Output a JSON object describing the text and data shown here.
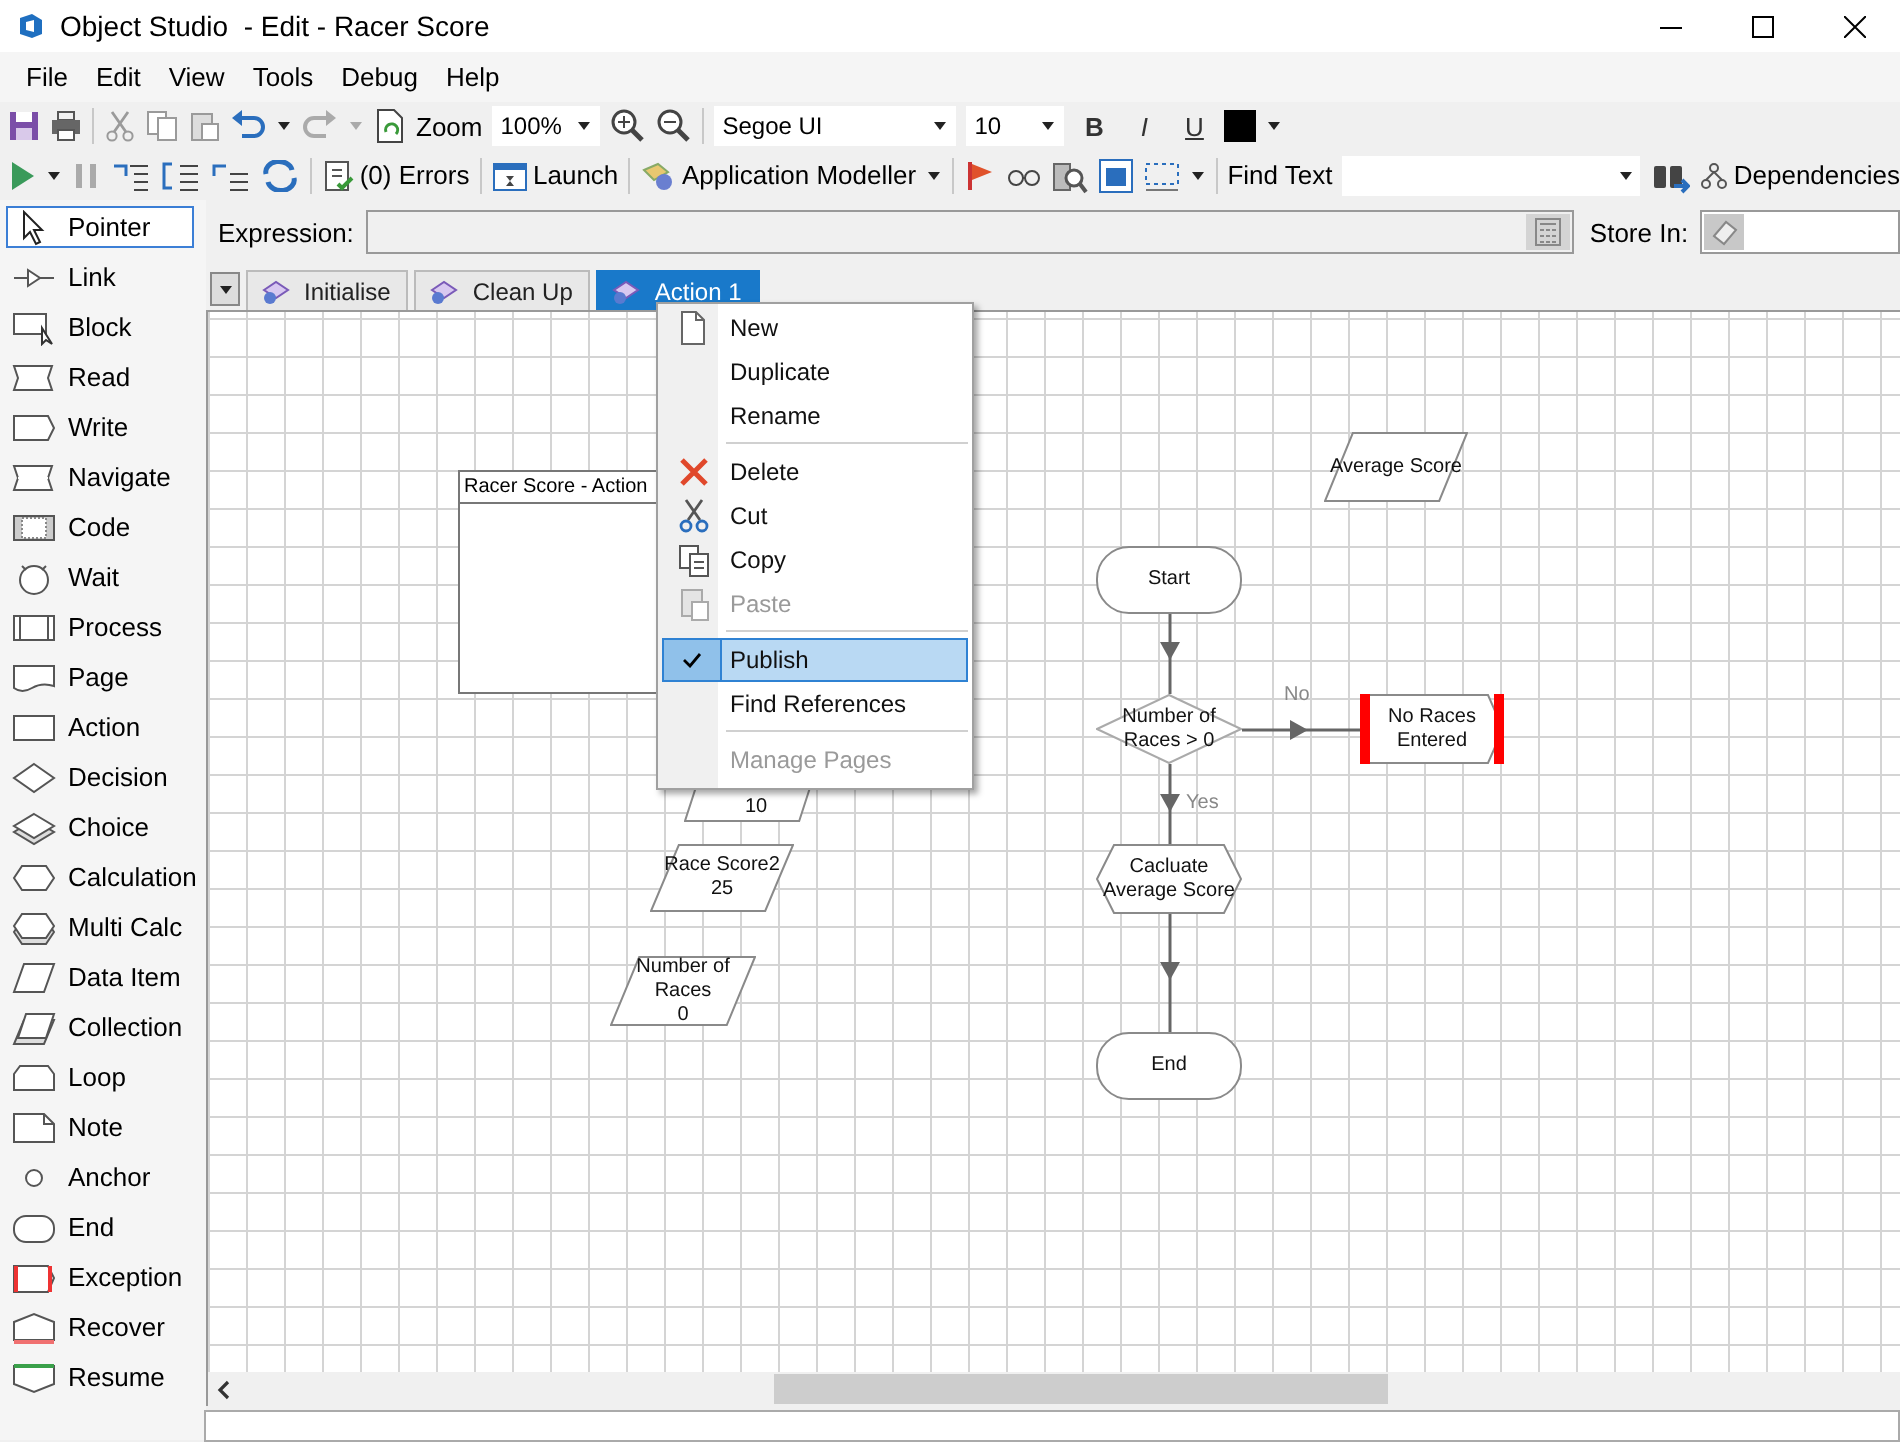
{
  "window": {
    "title": "Object Studio  - Edit - Racer Score"
  },
  "menu_bar": [
    "File",
    "Edit",
    "View",
    "Tools",
    "Debug",
    "Help"
  ],
  "toolbar_1": {
    "zoom_label": "Zoom",
    "zoom_value": "100%",
    "font_name": "Segoe UI",
    "font_size": "10",
    "format_buttons": [
      "B",
      "I",
      "U"
    ]
  },
  "toolbar_2": {
    "errors": "(0) Errors",
    "launch": "Launch",
    "application_modeller": "Application Modeller",
    "find_text_label": "Find Text",
    "dependencies": "Dependencies"
  },
  "palette": [
    {
      "label": "Pointer",
      "selected": true
    },
    {
      "label": "Link",
      "selected": false
    },
    {
      "label": "Block",
      "selected": false
    },
    {
      "label": "Read",
      "selected": false
    },
    {
      "label": "Write",
      "selected": false
    },
    {
      "label": "Navigate",
      "selected": false
    },
    {
      "label": "Code",
      "selected": false
    },
    {
      "label": "Wait",
      "selected": false
    },
    {
      "label": "Process",
      "selected": false
    },
    {
      "label": "Page",
      "selected": false
    },
    {
      "label": "Action",
      "selected": false
    },
    {
      "label": "Decision",
      "selected": false
    },
    {
      "label": "Choice",
      "selected": false
    },
    {
      "label": "Calculation",
      "selected": false
    },
    {
      "label": "Multi Calc",
      "selected": false
    },
    {
      "label": "Data Item",
      "selected": false
    },
    {
      "label": "Collection",
      "selected": false
    },
    {
      "label": "Loop",
      "selected": false
    },
    {
      "label": "Note",
      "selected": false
    },
    {
      "label": "Anchor",
      "selected": false
    },
    {
      "label": "End",
      "selected": false
    },
    {
      "label": "Exception",
      "selected": false
    },
    {
      "label": "Recover",
      "selected": false
    },
    {
      "label": "Resume",
      "selected": false
    }
  ],
  "expression": {
    "label": "Expression:",
    "store_in_label": "Store In:"
  },
  "tabs": [
    {
      "label": "Initialise",
      "selected": false
    },
    {
      "label": "Clean Up",
      "selected": false
    },
    {
      "label": "Action 1",
      "selected": true
    }
  ],
  "canvas": {
    "stages": [
      {
        "kind": "block",
        "label": "Racer Score - Action"
      },
      {
        "kind": "data",
        "label": "10"
      },
      {
        "kind": "data",
        "label": "Race Score2\n25"
      },
      {
        "kind": "data",
        "label": "Number of\nRaces\n0"
      },
      {
        "kind": "data",
        "label": "Average Score"
      },
      {
        "kind": "terminal",
        "label": "Start"
      },
      {
        "kind": "decision",
        "label": "Number of\nRaces > 0"
      },
      {
        "kind": "exception",
        "label": "No Races\nEntered"
      },
      {
        "kind": "calculation",
        "label": "Cacluate\nAverage Score"
      },
      {
        "kind": "terminal",
        "label": "End"
      }
    ],
    "link_labels": [
      "No",
      "Yes"
    ]
  },
  "context_menu": {
    "items": [
      {
        "kind": "item",
        "label": "New",
        "disabled": false,
        "checked": false,
        "selected": false
      },
      {
        "kind": "item",
        "label": "Duplicate",
        "disabled": false,
        "checked": false,
        "selected": false
      },
      {
        "kind": "item",
        "label": "Rename",
        "disabled": false,
        "checked": false,
        "selected": false
      },
      {
        "kind": "separator"
      },
      {
        "kind": "item",
        "label": "Delete",
        "disabled": false,
        "checked": false,
        "selected": false
      },
      {
        "kind": "item",
        "label": "Cut",
        "disabled": false,
        "checked": false,
        "selected": false
      },
      {
        "kind": "item",
        "label": "Copy",
        "disabled": false,
        "checked": false,
        "selected": false
      },
      {
        "kind": "item",
        "label": "Paste",
        "disabled": true,
        "checked": false,
        "selected": false
      },
      {
        "kind": "separator"
      },
      {
        "kind": "item",
        "label": "Publish",
        "disabled": false,
        "checked": true,
        "selected": true
      },
      {
        "kind": "item",
        "label": "Find References",
        "disabled": false,
        "checked": false,
        "selected": false
      },
      {
        "kind": "separator"
      },
      {
        "kind": "item",
        "label": "Manage Pages",
        "disabled": true,
        "checked": false,
        "selected": false
      }
    ]
  }
}
